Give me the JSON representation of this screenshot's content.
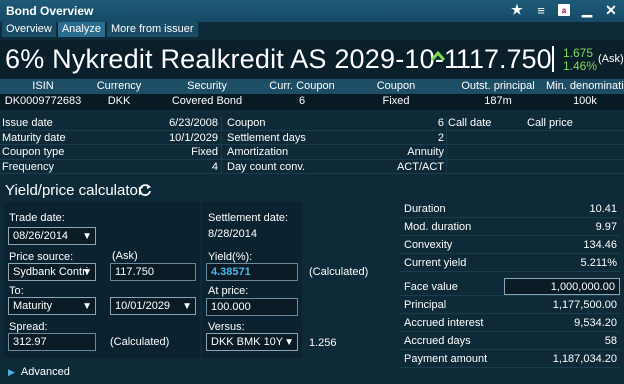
{
  "window": {
    "title": "Bond Overview"
  },
  "tabs": [
    "Overview",
    "Analyze",
    "More from issuer"
  ],
  "headline": {
    "bond_name": "6% Nykredit Realkredit AS 2029-10-1",
    "price": "117.750",
    "change_abs": "1.675",
    "change_pct": "1.46%",
    "ask_label": "(Ask)"
  },
  "summary": {
    "headers": [
      "ISIN",
      "Currency",
      "Security",
      "Curr. Coupon",
      "Coupon",
      "Outst. principal",
      "Min. denomination"
    ],
    "values": [
      "DK0009772683",
      "DKK",
      "Covered Bond",
      "6",
      "Fixed",
      "187m",
      "100k"
    ]
  },
  "details": {
    "rows": [
      [
        "Issue date",
        "6/23/2008",
        "Coupon",
        "6",
        "Call date",
        "Call price"
      ],
      [
        "Maturity date",
        "10/1/2029",
        "Settlement days",
        "2",
        "",
        ""
      ],
      [
        "Coupon type",
        "Fixed",
        "Amortization",
        "Annuity",
        "",
        ""
      ],
      [
        "Frequency",
        "4",
        "Day count conv.",
        "ACT/ACT",
        "",
        ""
      ]
    ]
  },
  "calculator": {
    "title": "Yield/price calculator",
    "trade_date_label": "Trade date:",
    "trade_date": "08/26/2014",
    "price_source_label": "Price source:",
    "price_source": "Sydbank Contri",
    "ask_label": "(Ask)",
    "price_value": "117.750",
    "to_label": "To:",
    "to_value": "Maturity",
    "to_date": "10/01/2029",
    "spread_label": "Spread:",
    "spread_value": "312.97",
    "calculated_label": "(Calculated)",
    "settlement_label": "Settlement date:",
    "settlement_date": "8/28/2014",
    "yield_label": "Yield(%):",
    "yield_value": "4.38571",
    "yield_calculated": "(Calculated)",
    "at_price_label": "At price:",
    "at_price_value": "100.000",
    "versus_label": "Versus:",
    "versus_value": "DKK BMK 10Y",
    "versus_number": "1.256"
  },
  "stats": {
    "risk": [
      [
        "Duration",
        "10.41"
      ],
      [
        "Mod. duration",
        "9.97"
      ],
      [
        "Convexity",
        "134.46"
      ],
      [
        "Current yield",
        "5.211%"
      ]
    ],
    "face_value_label": "Face value",
    "face_value": "1,000,000.00",
    "cash": [
      [
        "Principal",
        "1,177,500.00"
      ],
      [
        "Accrued interest",
        "9,534.20"
      ],
      [
        "Accrued days",
        "58"
      ],
      [
        "Payment amount",
        "1,187,034.20"
      ]
    ]
  },
  "footer": {
    "advanced_label": "Advanced"
  },
  "colors": {
    "background": "#0e2a38",
    "titlebar": "#1d5a78",
    "positive": "#7ed957",
    "yield": "#49b3e6"
  }
}
